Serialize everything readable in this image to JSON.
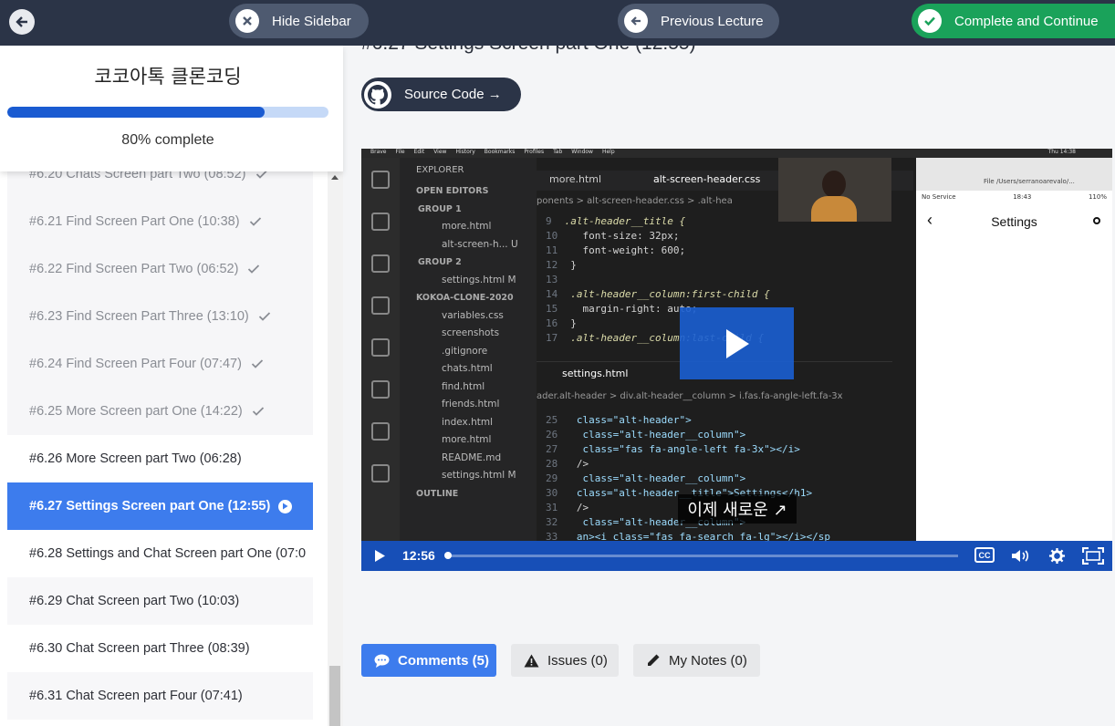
{
  "topbar": {
    "hide_sidebar": "Hide Sidebar",
    "previous_lecture": "Previous Lecture",
    "complete_continue": "Complete and Continue"
  },
  "sidebar": {
    "course_title": "코코아톡 클론코딩",
    "progress_percent": 80,
    "progress_text": "80% complete",
    "lectures": [
      {
        "label": "#6.20 Chats Screen part Two (08:52)",
        "state": "done"
      },
      {
        "label": "#6.21 Find Screen Part One (10:38)",
        "state": "done"
      },
      {
        "label": "#6.22 Find Screen Part Two (06:52)",
        "state": "done"
      },
      {
        "label": "#6.23 Find Screen Part Three (13:10)",
        "state": "done"
      },
      {
        "label": "#6.24 Find Screen Part Four (07:47)",
        "state": "done"
      },
      {
        "label": "#6.25 More Screen part One (14:22)",
        "state": "done"
      },
      {
        "label": "#6.26 More Screen part Two (06:28)",
        "state": "plain"
      },
      {
        "label": "#6.27 Settings Screen part One (12:55)",
        "state": "active"
      },
      {
        "label": "#6.28 Settings and Chat Screen part One (07:0",
        "state": "plain"
      },
      {
        "label": "#6.29 Chat Screen part Two (10:03)",
        "state": "plain"
      },
      {
        "label": "#6.30 Chat Screen part Three (08:39)",
        "state": "plain"
      },
      {
        "label": "#6.31 Chat Screen part Four (07:41)",
        "state": "plain"
      }
    ]
  },
  "main": {
    "title": "#6.27 Settings Screen part One (12:55)",
    "source_code": "Source Code →"
  },
  "video": {
    "mac_menu": [
      "Brave",
      "File",
      "Edit",
      "View",
      "History",
      "Bookmarks",
      "Profiles",
      "Tab",
      "Window",
      "Help"
    ],
    "mac_clock": "Thu 14:38",
    "explorer": {
      "title": "EXPLORER",
      "open_editors": "OPEN EDITORS",
      "group1": "GROUP 1",
      "group1_files": [
        "more.html",
        "alt-screen-h...   U"
      ],
      "group2": "GROUP 2",
      "group2_files": [
        "settings.html   M"
      ],
      "project": "KOKOA-CLONE-2020",
      "project_files": [
        "variables.css",
        "screenshots",
        ".gitignore",
        "chats.html",
        "find.html",
        "friends.html",
        "index.html",
        "more.html",
        "README.md",
        "settings.html   M"
      ],
      "outline": "OUTLINE"
    },
    "editor_tabs": [
      "more.html",
      "alt-screen-header.css"
    ],
    "breadcrumb_top": "ponents  >  alt-screen-header.css  >  .alt-hea",
    "code_top": [
      {
        "n": "9",
        "t": ".alt-header__title {"
      },
      {
        "n": "10",
        "t": "  font-size: 32px;"
      },
      {
        "n": "11",
        "t": "  font-weight: 600;"
      },
      {
        "n": "12",
        "t": "}"
      },
      {
        "n": "13",
        "t": ""
      },
      {
        "n": "14",
        "t": ".alt-header__column:first-child {"
      },
      {
        "n": "15",
        "t": "  margin-right: auto;"
      },
      {
        "n": "16",
        "t": "}"
      },
      {
        "n": "17",
        "t": ".alt-header__column:last-child {"
      }
    ],
    "lower_tab": "settings.html",
    "breadcrumb_bottom": "ader.alt-header  >  div.alt-header__column  >  i.fas.fa-angle-left.fa-3x",
    "code_bottom": [
      {
        "n": "25",
        "t": " class=\"alt-header\">"
      },
      {
        "n": "26",
        "t": "  class=\"alt-header__column\">"
      },
      {
        "n": "27",
        "t": "  class=\"fas fa-angle-left fa-3x\"></i>"
      },
      {
        "n": "28",
        "t": " />"
      },
      {
        "n": "29",
        "t": "  class=\"alt-header__column\">"
      },
      {
        "n": "30",
        "t": " class=\"alt-header__title\">Settings</h1>"
      },
      {
        "n": "31",
        "t": " />"
      },
      {
        "n": "32",
        "t": "  class=\"alt-header__column\">"
      },
      {
        "n": "33",
        "t": " an><i class=\"fas fa-search fa-lg\"></i></sp"
      }
    ],
    "phone": {
      "carrier": "No Service",
      "time": "18:43",
      "battery": "110%",
      "url": "File  /Users/serranoarevalo/...",
      "title": "Settings"
    },
    "caption": "이제 새로운 ↗",
    "time": "12:56",
    "progress_fraction": 0.0
  },
  "bottom_tabs": {
    "comments": "Comments (5)",
    "issues": "Issues (0)",
    "notes": "My Notes (0)"
  }
}
